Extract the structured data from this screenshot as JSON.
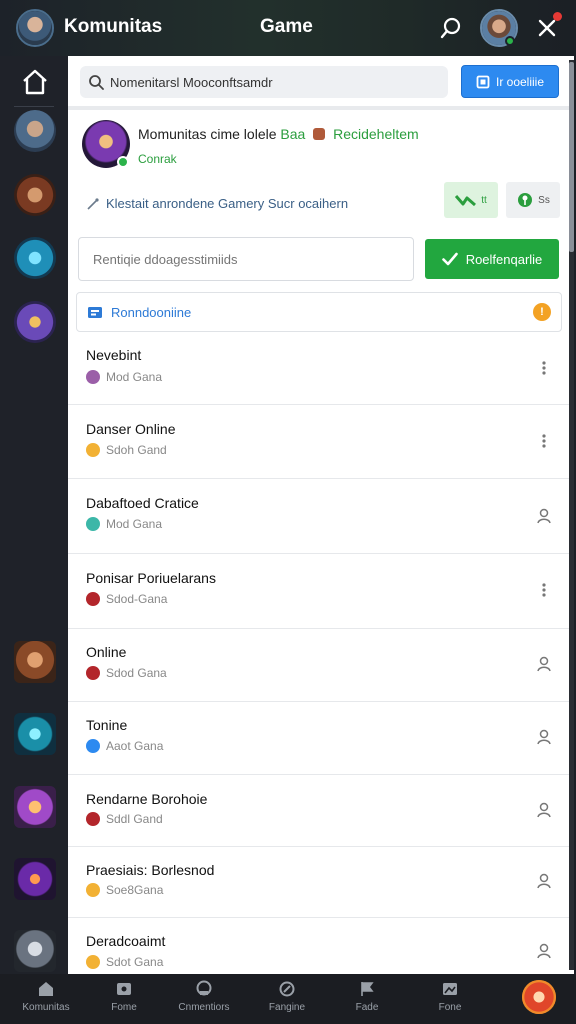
{
  "header": {
    "title": "Komunitas",
    "center_title": "Game"
  },
  "search": {
    "value": "Nomenitarsl Mooconftsamdr",
    "button_label": "Ir ooeliiie"
  },
  "profile": {
    "title_main": "Momunitas cime lolele",
    "title_green_1": "Baa",
    "title_green_2": "Recideheltem",
    "status": "Conrak",
    "description": "Klestait anrondene Gamery Sucr ocaihern",
    "stat_green": "tt",
    "stat_grey": "Ss"
  },
  "reply": {
    "placeholder": "Rentiqie ddoagesstimiids",
    "button_label": "Roelfenqarlie"
  },
  "section": {
    "label": "Ronndooniine",
    "badge": "!"
  },
  "rows": [
    {
      "name": "Nevebint",
      "sub": "Mod Gana",
      "action": "more-icon",
      "icon_color": "#9b5fa8"
    },
    {
      "name": "Danser Online",
      "sub": "Sdoh Gand",
      "action": "more-icon",
      "icon_color": "#f2b134"
    },
    {
      "name": "Dabaftoed Cratice",
      "sub": "Mod Gana",
      "action": "person-icon",
      "icon_color": "#3cb7a8"
    },
    {
      "name": "Ponisar Poriuelarans",
      "sub": "Sdod-Gana",
      "action": "more-icon",
      "icon_color": "#b3262b"
    },
    {
      "name": "Online",
      "sub": "Sdod Gana",
      "action": "person-icon",
      "icon_color": "#b3262b"
    },
    {
      "name": "Tonine",
      "sub": "Aaot Gana",
      "action": "person-icon",
      "icon_color": "#2d8af0"
    },
    {
      "name": "Rendarne Borohoie",
      "sub": "Sddl Gand",
      "action": "person-icon",
      "icon_color": "#b3262b"
    },
    {
      "name": "Praesiais: Borlesnod",
      "sub": "Soe8Gana",
      "action": "person-icon",
      "icon_color": "#f2b134"
    },
    {
      "name": "Deradcoaimt",
      "sub": "Sdot Gana",
      "action": "person-icon",
      "icon_color": "#f2b134"
    }
  ],
  "bottom_nav": [
    {
      "label": "Komunitas",
      "icon": "home-icon"
    },
    {
      "label": "Fome",
      "icon": "game-icon"
    },
    {
      "label": "Cnmentiors",
      "icon": "chat-icon"
    },
    {
      "label": "Fangine",
      "icon": "compass-icon"
    },
    {
      "label": "Fade",
      "icon": "flag-icon"
    },
    {
      "label": "Fone",
      "icon": "gallery-icon"
    }
  ],
  "colors": {
    "accent_blue": "#2d8af0",
    "accent_green": "#22a73f",
    "sidebar_bg": "#1f2229",
    "badge_orange": "#f3a224"
  }
}
